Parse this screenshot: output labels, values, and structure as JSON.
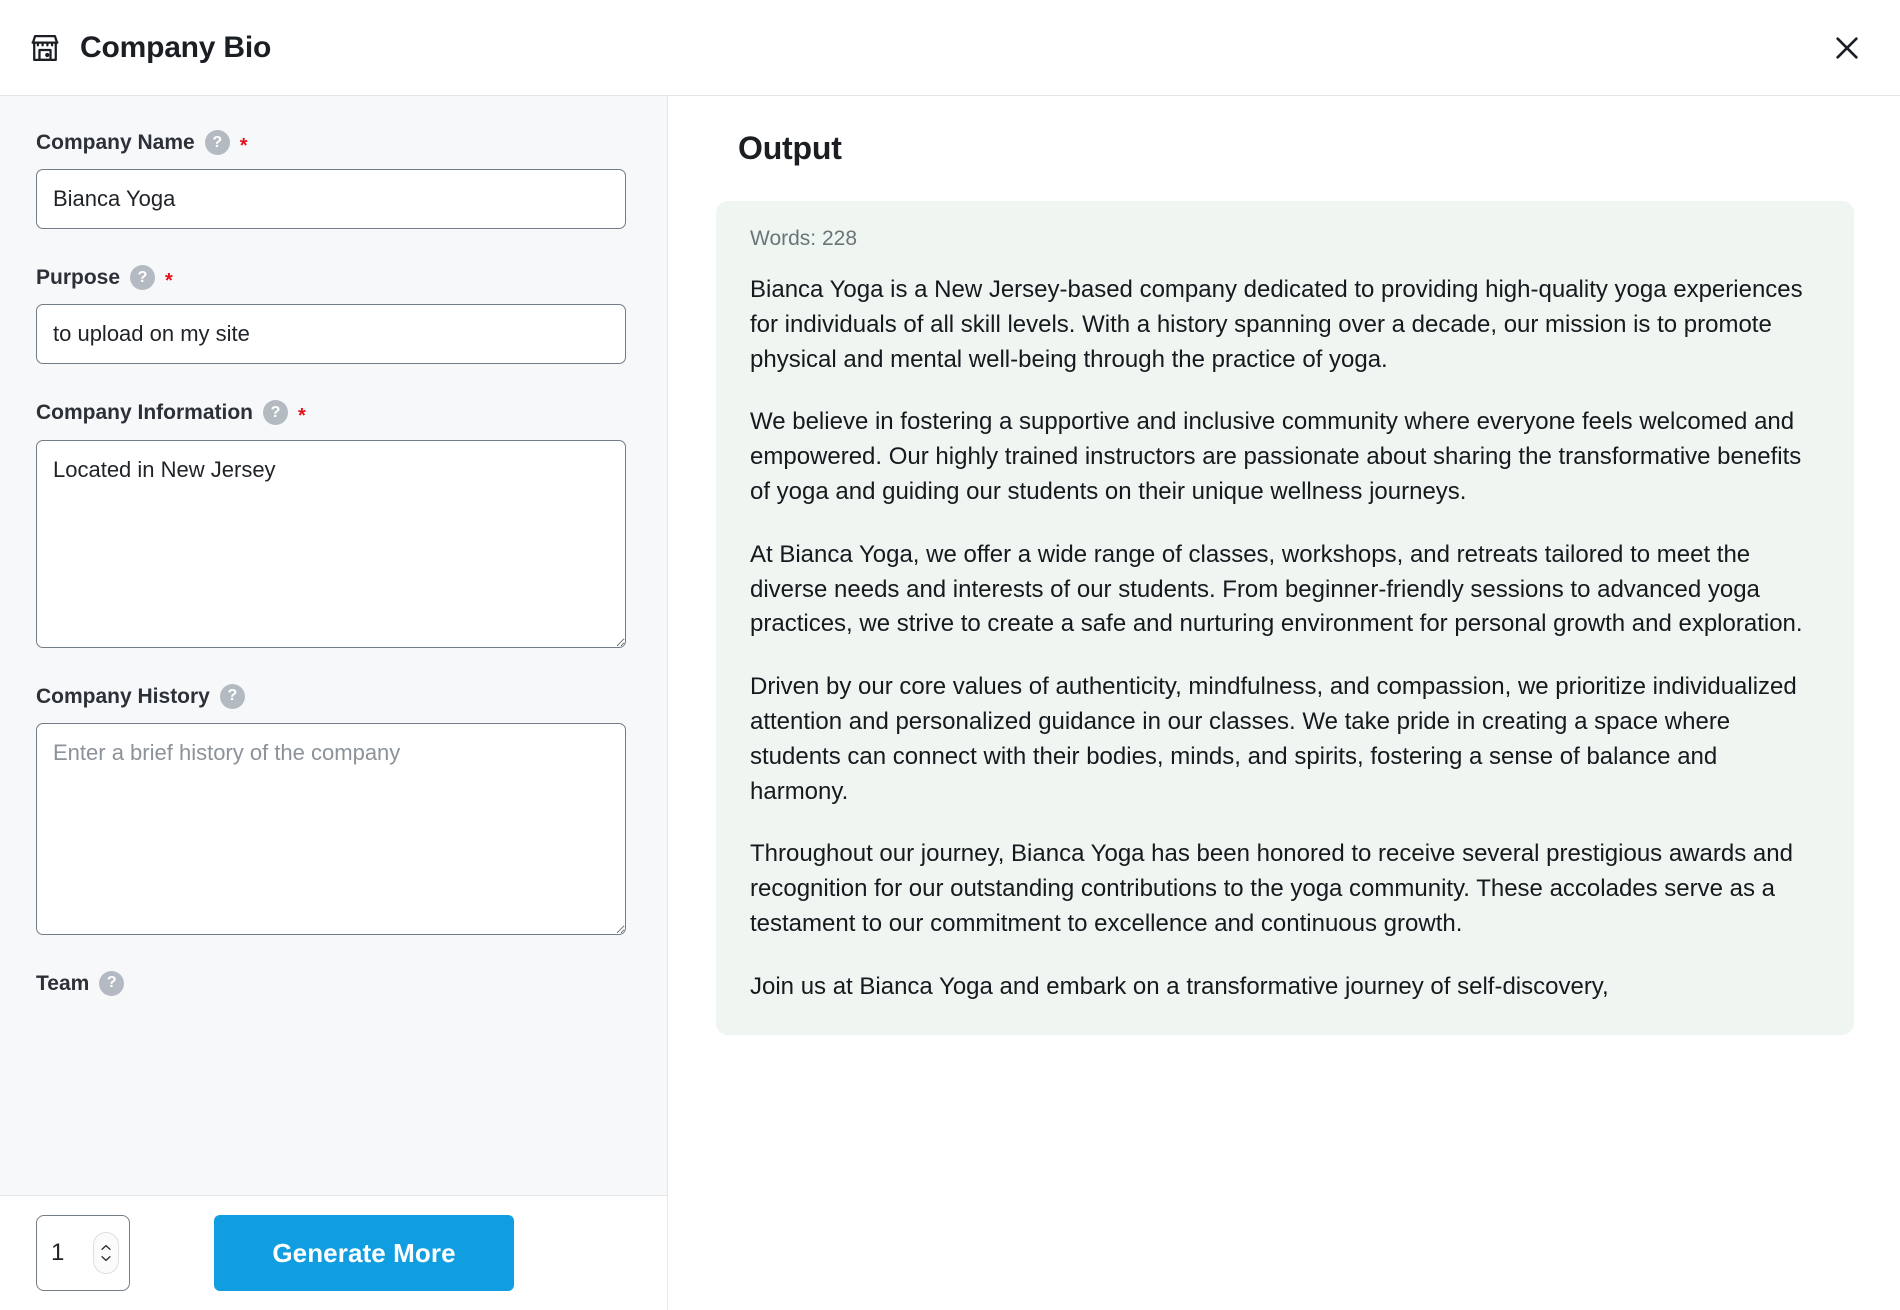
{
  "header": {
    "title": "Company Bio",
    "icon": "storefront-icon",
    "close_label": "×"
  },
  "form": {
    "fields": [
      {
        "label": "Company Name",
        "required": true,
        "help": "?",
        "type": "input",
        "value": "Bianca Yoga",
        "placeholder": ""
      },
      {
        "label": "Purpose",
        "required": true,
        "help": "?",
        "type": "input",
        "value": "to upload on my site",
        "placeholder": ""
      },
      {
        "label": "Company Information",
        "required": true,
        "help": "?",
        "type": "textarea",
        "value": "Located in New Jersey",
        "placeholder": ""
      },
      {
        "label": "Company History",
        "required": false,
        "help": "?",
        "type": "textarea",
        "value": "",
        "placeholder": "Enter a brief history of the company"
      },
      {
        "label": "Team",
        "required": false,
        "help": "?",
        "type": "clipped",
        "value": "",
        "placeholder": ""
      }
    ]
  },
  "footer": {
    "count_value": "1",
    "increment_label": "▲",
    "decrement_label": "▼",
    "generate_label": "Generate More"
  },
  "output": {
    "title": "Output",
    "word_count_label": "Words: 228",
    "paragraphs": [
      "Bianca Yoga is a New Jersey-based company dedicated to providing high-quality yoga experiences for individuals of all skill levels. With a history spanning over a decade, our mission is to promote physical and mental well-being through the practice of yoga.",
      "We believe in fostering a supportive and inclusive community where everyone feels welcomed and empowered. Our highly trained instructors are passionate about sharing the transformative benefits of yoga and guiding our students on their unique wellness journeys.",
      "At Bianca Yoga, we offer a wide range of classes, workshops, and retreats tailored to meet the diverse needs and interests of our students. From beginner-friendly sessions to advanced yoga practices, we strive to create a safe and nurturing environment for personal growth and exploration.",
      "Driven by our core values of authenticity, mindfulness, and compassion, we prioritize individualized attention and personalized guidance in our classes. We take pride in creating a space where students can connect with their bodies, minds, and spirits, fostering a sense of balance and harmony.",
      "Throughout our journey, Bianca Yoga has been honored to receive several prestigious awards and recognition for our outstanding contributions to the yoga community. These accolades serve as a testament to our commitment to excellence and continuous growth.",
      "Join us at Bianca Yoga and embark on a transformative journey of self-discovery,"
    ]
  },
  "colors": {
    "accent_blue": "#109ee0",
    "required_red": "#e4121b",
    "panel_bg": "#f7f8fa",
    "output_card_bg": "#eff5f1",
    "help_gray": "#b4bac2"
  }
}
